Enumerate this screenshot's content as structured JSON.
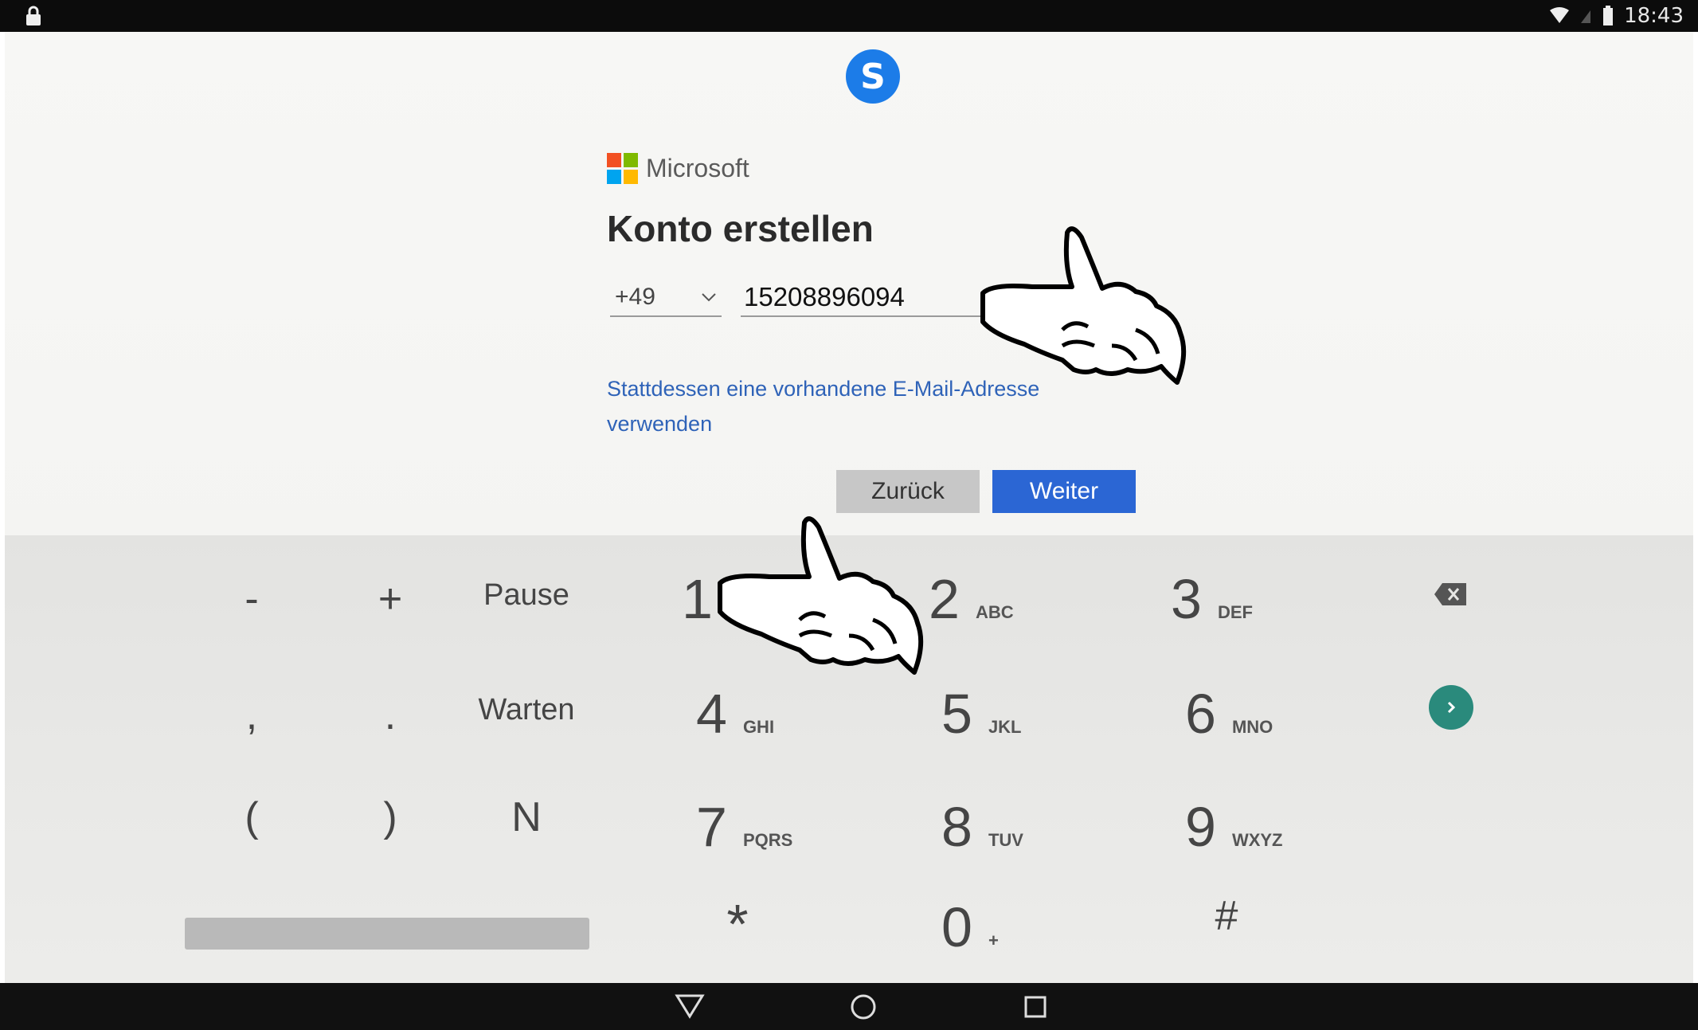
{
  "status_bar": {
    "time": "18:43",
    "left_icon": "lock-icon",
    "right_icons": [
      "wifi-icon",
      "signal-icon",
      "battery-icon"
    ]
  },
  "app": {
    "logo_letter": "S",
    "logo_icon": "skype-logo"
  },
  "microsoft": {
    "brand": "Microsoft",
    "colors": [
      "#f25022",
      "#7fba00",
      "#00a4ef",
      "#ffb900"
    ]
  },
  "form": {
    "title": "Konto erstellen",
    "country_code": "+49",
    "phone_value": "15208896094",
    "alt_link": "Stattdessen eine vorhandene E-Mail-Adresse verwenden",
    "back_label": "Zurück",
    "next_label": "Weiter",
    "accent": "#2b66d4"
  },
  "keypad": {
    "row1": {
      "minus": "-",
      "plus": "+",
      "pause": "Pause",
      "k1": "1",
      "k1_letters": "",
      "k2": "2",
      "k2_letters": "ABC",
      "k3": "3",
      "k3_letters": "DEF"
    },
    "row2": {
      "comma": ",",
      "period": ".",
      "wait": "Warten",
      "k4": "4",
      "k4_letters": "GHI",
      "k5": "5",
      "k5_letters": "JKL",
      "k6": "6",
      "k6_letters": "MNO"
    },
    "row3": {
      "lparen": "(",
      "rparen": ")",
      "n": "N",
      "k7": "7",
      "k7_letters": "PQRS",
      "k8": "8",
      "k8_letters": "TUV",
      "k9": "9",
      "k9_letters": "WXYZ"
    },
    "row4": {
      "star": "*",
      "k0": "0",
      "k0_letters": "+",
      "hash": "#"
    },
    "backspace_icon": "backspace-icon",
    "enter_icon": "chevron-right-icon",
    "enter_color": "#2a8a7c"
  },
  "nav_bar": {
    "icons": [
      "back-triangle-icon",
      "home-circle-icon",
      "recents-square-icon"
    ]
  },
  "annotations": [
    "pointing-hand-icon",
    "pointing-hand-icon"
  ]
}
